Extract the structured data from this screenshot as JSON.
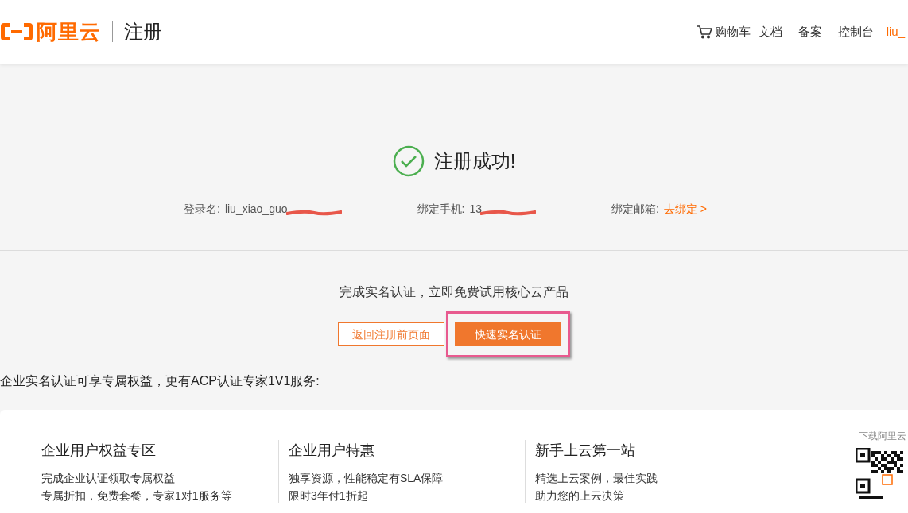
{
  "header": {
    "logo_text": "阿里云",
    "page_title": "注册",
    "nav": [
      {
        "label": "购物车",
        "kind": "cart"
      },
      {
        "label": "文档",
        "kind": "link"
      },
      {
        "label": "备案",
        "kind": "link"
      },
      {
        "label": "控制台",
        "kind": "link"
      },
      {
        "label": "liu_",
        "kind": "user"
      }
    ]
  },
  "result": {
    "title": "注册成功!",
    "fields": [
      {
        "label": "登录名:",
        "value": "liu_xiao_guo",
        "kind": "redacted"
      },
      {
        "label": "绑定手机:",
        "value": "13",
        "kind": "redacted"
      },
      {
        "label": "绑定邮箱:",
        "value": "去绑定 >",
        "kind": "link"
      }
    ]
  },
  "verify": {
    "prompt": "完成实名认证，立即免费试用核心云产品",
    "buttons": [
      {
        "label": "返回注册前页面",
        "kind": "outline",
        "highlighted": false
      },
      {
        "label": "快速实名认证",
        "kind": "primary",
        "highlighted": true
      }
    ]
  },
  "enterprise_note": "企业实名认证可享专属权益，更有ACP认证专家1V1服务:",
  "columns": [
    {
      "title": "企业用户权益专区",
      "lines": [
        "完成企业认证领取专属权益",
        "专属折扣，免费套餐，专家1对1服务等"
      ]
    },
    {
      "title": "企业用户特惠",
      "lines": [
        "独享资源，性能稳定有SLA保障",
        "限时3年付1折起"
      ]
    },
    {
      "title": "新手上云第一站",
      "lines": [
        "精选上云案例，最佳实践",
        "助力您的上云决策"
      ]
    }
  ],
  "app_download": {
    "label": "下载阿里云"
  }
}
